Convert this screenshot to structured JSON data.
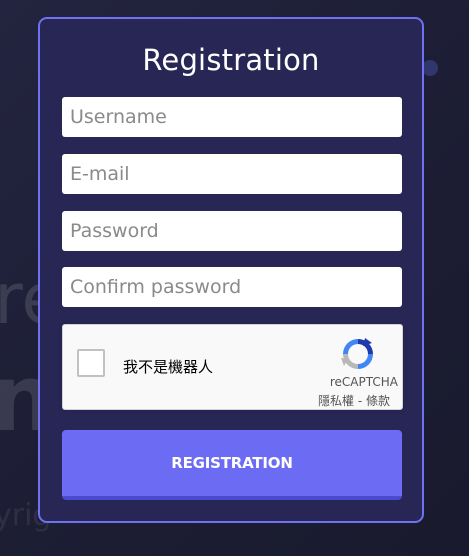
{
  "background": {
    "partial_text_1": "re",
    "partial_text_2": "n",
    "partial_text_3": "yrig"
  },
  "form": {
    "title": "Registration",
    "username_placeholder": "Username",
    "email_placeholder": "E-mail",
    "password_placeholder": "Password",
    "confirm_placeholder": "Confirm password",
    "submit_label": "REGISTRATION"
  },
  "captcha": {
    "label": "我不是機器人",
    "brand": "reCAPTCHA",
    "privacy": "隱私權",
    "separator": " - ",
    "terms": "條款",
    "logo_icon": "recaptcha-icon"
  },
  "colors": {
    "accent": "#6b6cf3",
    "card_border": "#6e71f0",
    "card_bg": "#272655",
    "page_bg": "#1f2038"
  }
}
